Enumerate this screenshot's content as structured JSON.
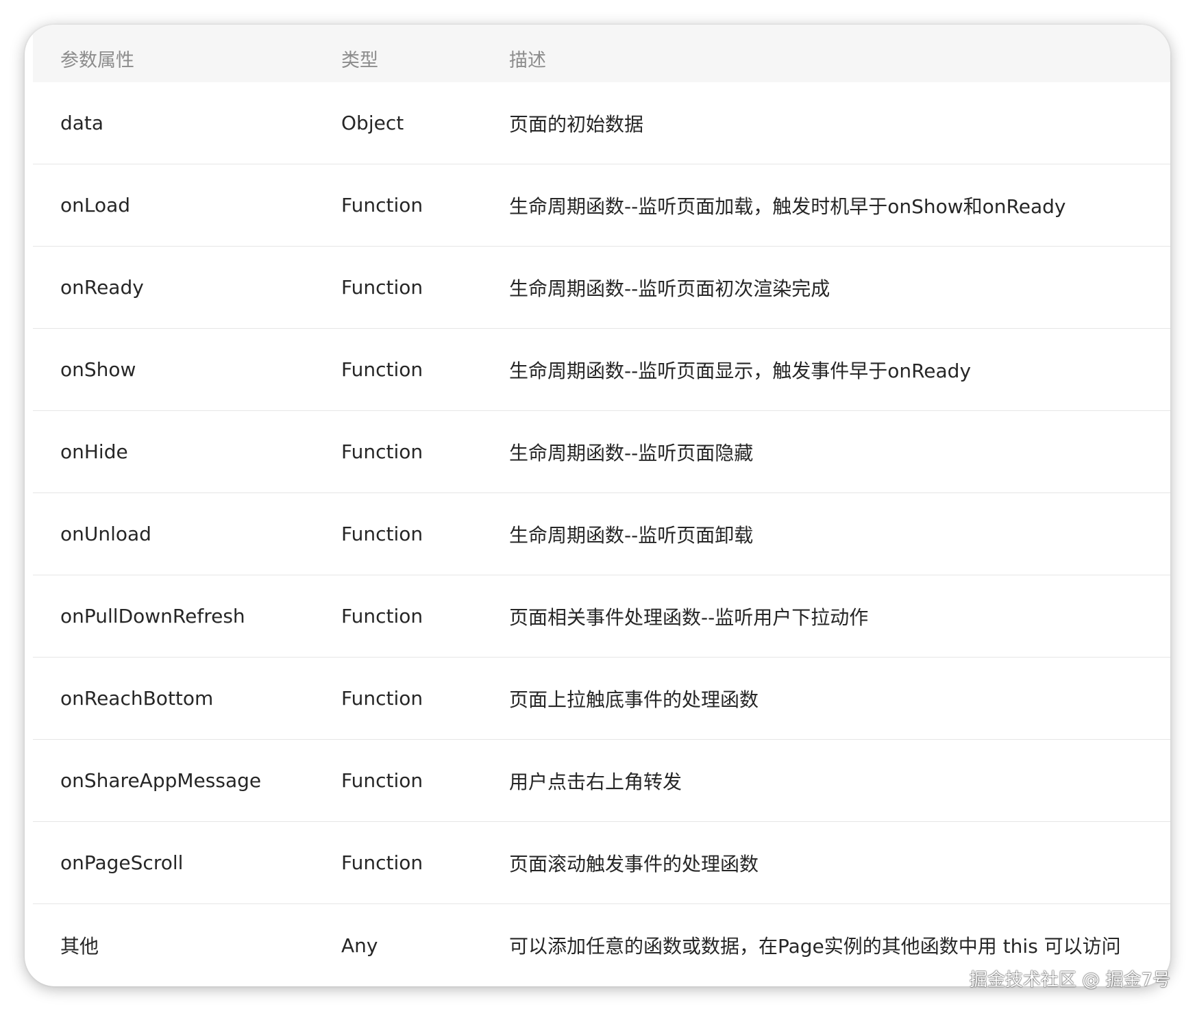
{
  "table": {
    "headers": [
      "参数属性",
      "类型",
      "描述"
    ],
    "rows": [
      {
        "name": "data",
        "type": "Object",
        "desc": "页面的初始数据"
      },
      {
        "name": "onLoad",
        "type": "Function",
        "desc": "生命周期函数--监听页面加载，触发时机早于onShow和onReady"
      },
      {
        "name": "onReady",
        "type": "Function",
        "desc": "生命周期函数--监听页面初次渲染完成"
      },
      {
        "name": "onShow",
        "type": "Function",
        "desc": "生命周期函数--监听页面显示，触发事件早于onReady"
      },
      {
        "name": "onHide",
        "type": "Function",
        "desc": "生命周期函数--监听页面隐藏"
      },
      {
        "name": "onUnload",
        "type": "Function",
        "desc": "生命周期函数--监听页面卸载"
      },
      {
        "name": "onPullDownRefresh",
        "type": "Function",
        "desc": "页面相关事件处理函数--监听用户下拉动作"
      },
      {
        "name": "onReachBottom",
        "type": "Function",
        "desc": "页面上拉触底事件的处理函数"
      },
      {
        "name": "onShareAppMessage",
        "type": "Function",
        "desc": "用户点击右上角转发"
      },
      {
        "name": "onPageScroll",
        "type": "Function",
        "desc": "页面滚动触发事件的处理函数"
      },
      {
        "name": "其他",
        "type": "Any",
        "desc": "可以添加任意的函数或数据，在Page实例的其他函数中用 this 可以访问"
      }
    ]
  },
  "watermark": "掘金技术社区 @ 掘金7号"
}
